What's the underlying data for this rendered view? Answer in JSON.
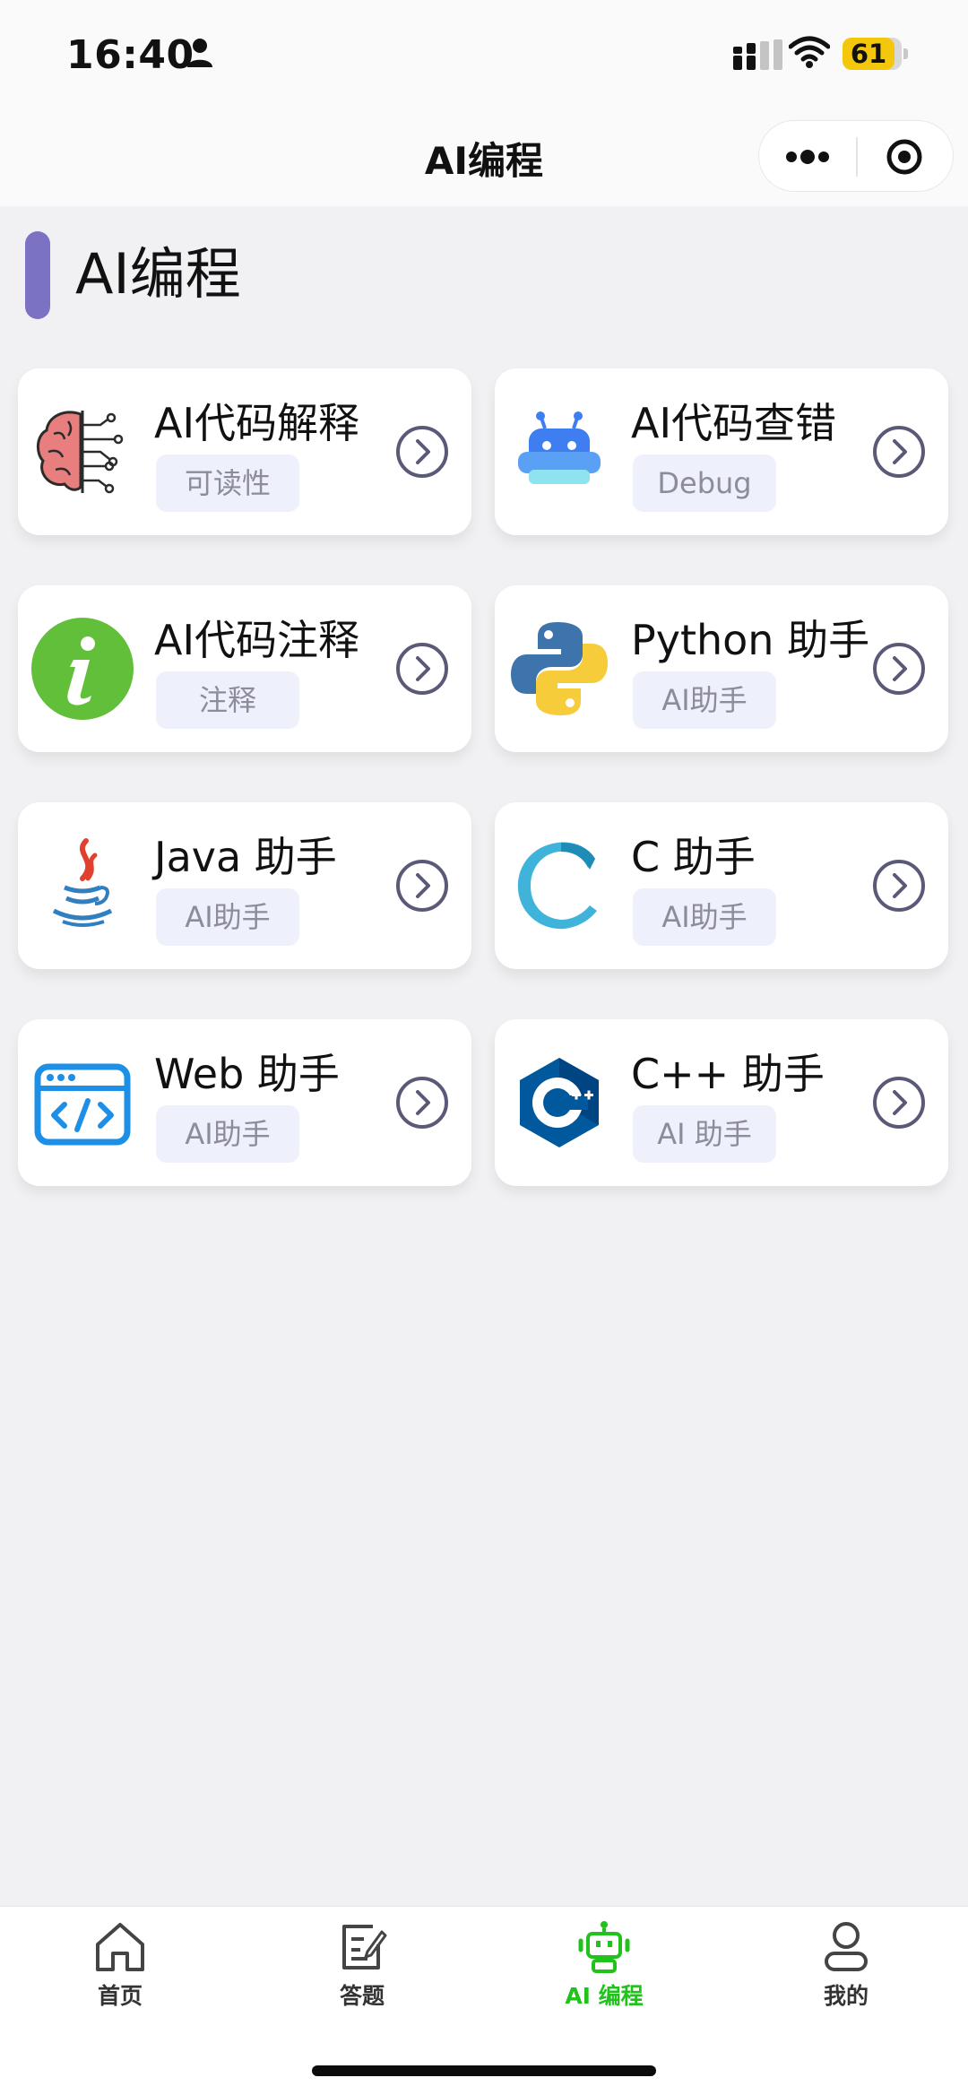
{
  "status_bar": {
    "time": "16:40",
    "battery": "61",
    "icons": [
      "person-icon",
      "signal-icon",
      "wifi-icon",
      "battery-icon"
    ]
  },
  "nav": {
    "title": "AI编程",
    "more_icon": "more-dots-icon",
    "close_icon": "target-close-icon"
  },
  "section": {
    "title": "AI编程",
    "accent": "#7b72c4"
  },
  "cards": [
    {
      "title": "AI代码解释",
      "tag": "可读性",
      "icon": "brain-circuit-icon"
    },
    {
      "title": "AI代码查错",
      "tag": "Debug",
      "icon": "robot-icon"
    },
    {
      "title": "AI代码注释",
      "tag": "注释",
      "icon": "info-icon"
    },
    {
      "title": "Python 助手",
      "tag": "AI助手",
      "icon": "python-logo-icon"
    },
    {
      "title": "Java 助手",
      "tag": "AI助手",
      "icon": "java-logo-icon"
    },
    {
      "title": "C 助手",
      "tag": "AI助手",
      "icon": "c-logo-icon"
    },
    {
      "title": "Web 助手",
      "tag": "AI助手",
      "icon": "web-code-icon"
    },
    {
      "title": "C++ 助手",
      "tag": "AI 助手",
      "icon": "cpp-logo-icon"
    }
  ],
  "tabs": [
    {
      "label": "首页",
      "icon": "home-icon",
      "active": false
    },
    {
      "label": "答题",
      "icon": "edit-note-icon",
      "active": false
    },
    {
      "label": "AI 编程",
      "icon": "robot-icon",
      "active": true
    },
    {
      "label": "我的",
      "icon": "user-icon",
      "active": false
    }
  ],
  "colors": {
    "active_tab": "#22c21c",
    "tag_bg": "#eef0fb",
    "arrow": "#5a5a78",
    "background": "#f1f1f3"
  }
}
